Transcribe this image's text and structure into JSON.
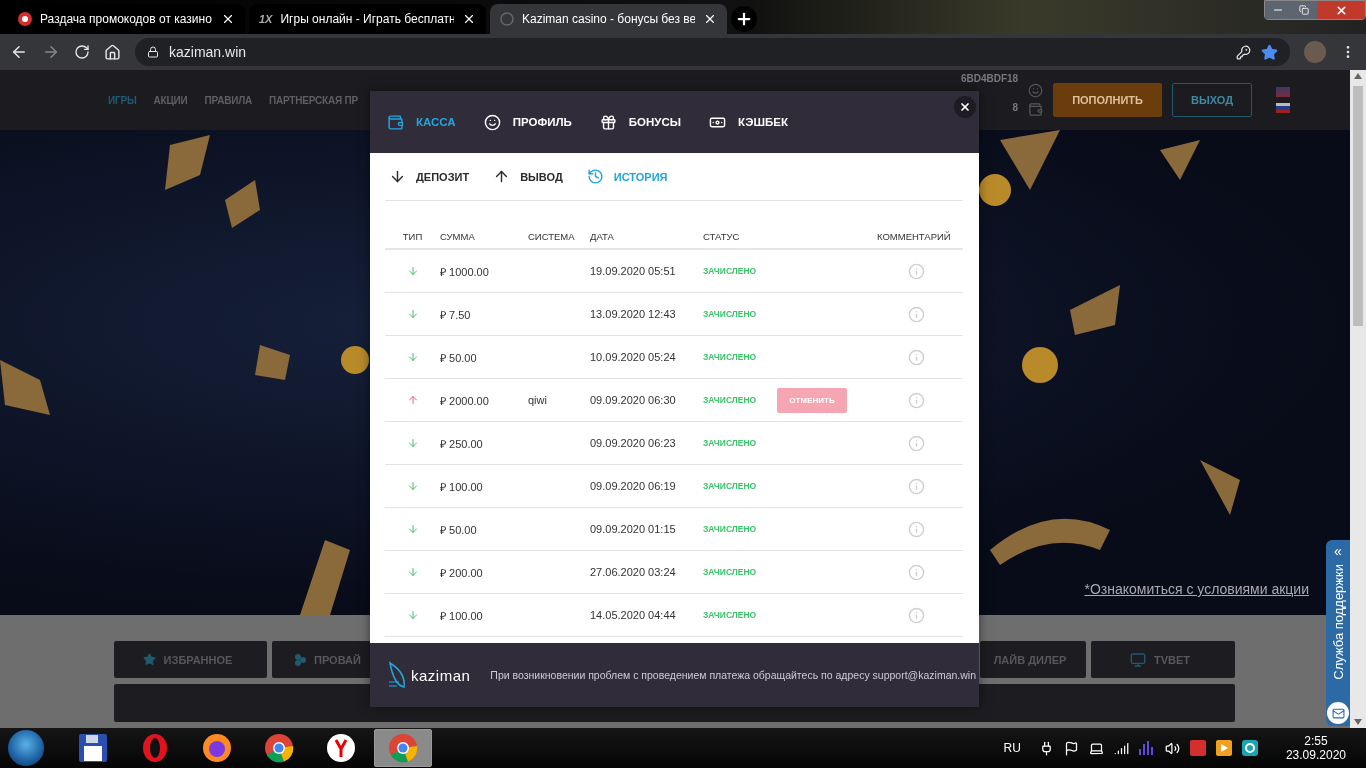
{
  "browser": {
    "tabs": [
      {
        "title": "Раздача промокодов от казино",
        "kind": "chip",
        "selected": false
      },
      {
        "title": "Игры онлайн - Играть бесплатн",
        "kind": "brand",
        "badge": "1X",
        "selected": false
      },
      {
        "title": "Kaziman casino - бонусы без ве",
        "kind": "loading",
        "selected": true
      }
    ],
    "address": "kaziman.win",
    "bookmarked": true
  },
  "site": {
    "nav": [
      {
        "label": "ИГРЫ",
        "selected": true
      },
      {
        "label": "АКЦИИ",
        "selected": false
      },
      {
        "label": "ПРАВИЛА",
        "selected": false
      },
      {
        "label": "ПАРТНЕРСКАЯ ПР",
        "selected": false
      }
    ],
    "user_id": "6BD4BDF18",
    "balance": "8",
    "deposit_button": "ПОПОЛНИТЬ",
    "logout_button": "ВЫХОД",
    "promo_link": "*Ознакомиться с условиями акции",
    "categories": [
      {
        "label": "ИЗБРАННОЕ"
      },
      {
        "label": "ПРОВАЙ"
      },
      {
        "label": "ЛАЙВ ДИЛЕР"
      },
      {
        "label": "TVBET"
      }
    ],
    "support": {
      "label": "Служба поддержки",
      "toggle": "«"
    }
  },
  "modal": {
    "tabs": [
      {
        "label": "КАССА",
        "selected": true
      },
      {
        "label": "ПРОФИЛЬ",
        "selected": false
      },
      {
        "label": "БОНУСЫ",
        "selected": false
      },
      {
        "label": "КЭШБЕК",
        "selected": false
      }
    ],
    "subtabs": [
      {
        "label": "ДЕПОЗИТ",
        "selected": false
      },
      {
        "label": "ВЫВОД",
        "selected": false
      },
      {
        "label": "ИСТОРИЯ",
        "selected": true
      }
    ],
    "table": {
      "columns": [
        "ТИП",
        "СУММА",
        "СИСТЕМА",
        "ДАТА",
        "СТАТУС",
        "КОММЕНТАРИЙ"
      ],
      "rows": [
        {
          "kind": "deposit",
          "amount": "₽ 1000.00",
          "date": "19.09.2020 05:51",
          "status": "ЗАЧИСЛЕНО"
        },
        {
          "kind": "deposit",
          "amount": "₽ 7.50",
          "date": "13.09.2020 12:43",
          "status": "ЗАЧИСЛЕНО"
        },
        {
          "kind": "deposit",
          "amount": "₽ 50.00",
          "date": "10.09.2020 05:24",
          "status": "ЗАЧИСЛЕНО"
        },
        {
          "kind": "withdrawal",
          "amount": "₽ 2000.00",
          "system": "qiwi",
          "date": "09.09.2020 06:30",
          "status": "ЗАЧИСЛЕНО",
          "action": "ОТМЕНИТЬ"
        },
        {
          "kind": "deposit",
          "amount": "₽ 250.00",
          "date": "09.09.2020 06:23",
          "status": "ЗАЧИСЛЕНО"
        },
        {
          "kind": "deposit",
          "amount": "₽ 100.00",
          "date": "09.09.2020 06:19",
          "status": "ЗАЧИСЛЕНО"
        },
        {
          "kind": "deposit",
          "amount": "₽ 50.00",
          "date": "09.09.2020 01:15",
          "status": "ЗАЧИСЛЕНО"
        },
        {
          "kind": "deposit",
          "amount": "₽ 200.00",
          "date": "27.06.2020 03:24",
          "status": "ЗАЧИСЛЕНО"
        },
        {
          "kind": "deposit",
          "amount": "₽ 100.00",
          "date": "14.05.2020 04:44",
          "status": "ЗАЧИСЛЕНО"
        }
      ]
    },
    "footer": {
      "logo": "kaziman",
      "note": "При возникновении проблем с проведением платежа обращайтесь по адресу support@kaziman.win"
    }
  },
  "taskbar": {
    "apps": [
      {
        "kind": "floppy",
        "selected": false
      },
      {
        "kind": "ring",
        "selected": false
      },
      {
        "kind": "fox",
        "selected": false
      },
      {
        "kind": "chrome",
        "selected": false
      },
      {
        "kind": "yandex",
        "selected": false
      },
      {
        "kind": "chrome",
        "selected": true
      }
    ],
    "language": "RU",
    "time": "2:55",
    "date": "23.09.2020"
  }
}
